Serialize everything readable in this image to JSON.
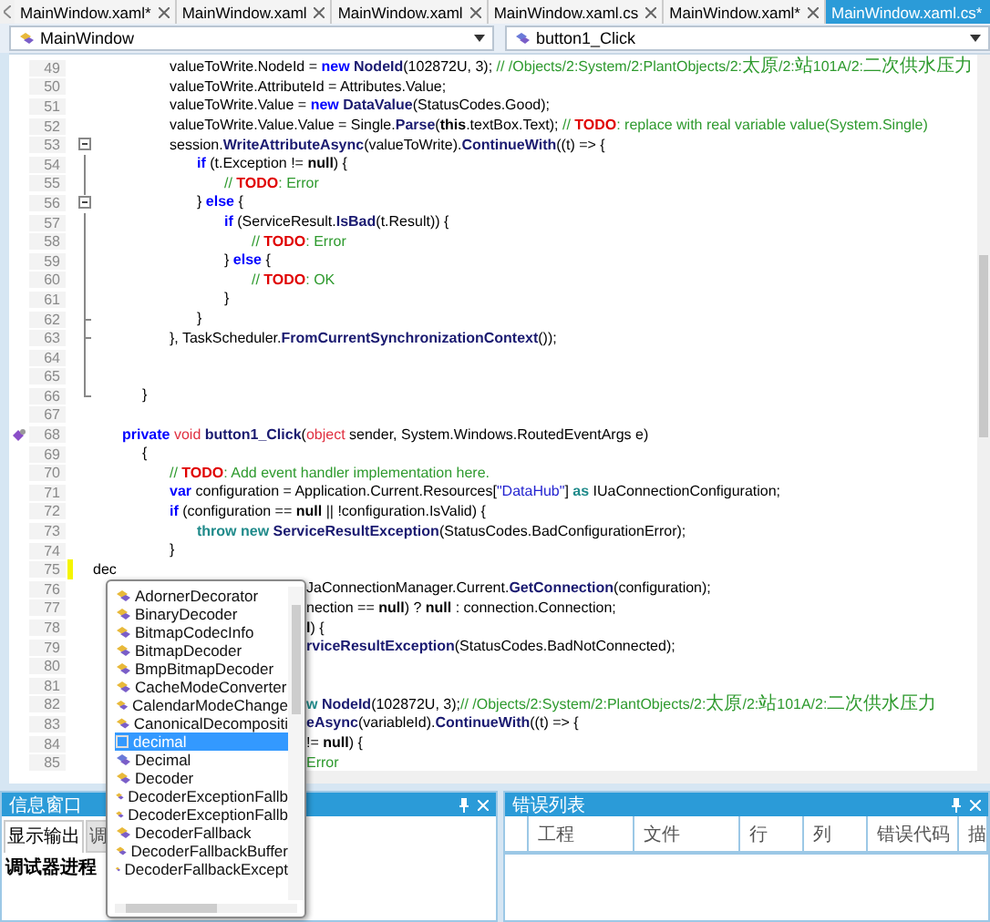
{
  "tabs": [
    {
      "label": "MainWindow.xaml*",
      "selected": false
    },
    {
      "label": "MainWindow.xaml",
      "selected": false
    },
    {
      "label": "MainWindow.xaml",
      "selected": false
    },
    {
      "label": "MainWindow.xaml.cs",
      "selected": false
    },
    {
      "label": "MainWindow.xaml*",
      "selected": false
    },
    {
      "label": "MainWindow.xaml.cs*",
      "selected": true
    }
  ],
  "type_dropdown": {
    "value": "MainWindow"
  },
  "member_dropdown": {
    "value": "button1_Click"
  },
  "editor": {
    "lines": [
      {
        "num": "49",
        "kind": "indent3",
        "tokens": [
          {
            "kind": "t",
            "text": "valueToWrite.NodeId = "
          },
          {
            "kind": "k",
            "text": "new "
          },
          {
            "kind": "m",
            "text": "NodeId"
          },
          {
            "kind": "t",
            "text": "(102872U, 3); "
          },
          {
            "kind": "c",
            "text": "// /Objects/2:System/2:PlantObjects/2:"
          },
          {
            "kind": "cjk",
            "text": "太原"
          },
          {
            "kind": "c",
            "text": "/2:"
          },
          {
            "kind": "cjk",
            "text": "站"
          },
          {
            "kind": "c",
            "text": "101A/2:"
          },
          {
            "kind": "cjk",
            "text": "二次供水压力"
          }
        ]
      },
      {
        "num": "50",
        "kind": "indent3",
        "tokens": [
          {
            "kind": "t",
            "text": "valueToWrite.AttributeId = Attributes.Value;"
          }
        ]
      },
      {
        "num": "51",
        "kind": "indent3",
        "tokens": [
          {
            "kind": "t",
            "text": "valueToWrite.Value = "
          },
          {
            "kind": "k",
            "text": "new "
          },
          {
            "kind": "m",
            "text": "DataValue"
          },
          {
            "kind": "t",
            "text": "(StatusCodes.Good);"
          }
        ]
      },
      {
        "num": "52",
        "kind": "indent3",
        "tokens": [
          {
            "kind": "t",
            "text": "valueToWrite.Value.Value = Single."
          },
          {
            "kind": "m",
            "text": "Parse"
          },
          {
            "kind": "t",
            "text": "("
          },
          {
            "kind": "b",
            "text": "this"
          },
          {
            "kind": "t",
            "text": ".textBox.Text); "
          },
          {
            "kind": "c",
            "text": "// "
          },
          {
            "kind": "todo",
            "text": "TODO"
          },
          {
            "kind": "c",
            "text": ": replace with real variable value(System.Single)"
          }
        ]
      },
      {
        "num": "53",
        "kind": "indent3",
        "fold": {
          "kind": "minus"
        },
        "tokens": [
          {
            "kind": "t",
            "text": "session."
          },
          {
            "kind": "m",
            "text": "WriteAttributeAsync"
          },
          {
            "kind": "t",
            "text": "(valueToWrite)."
          },
          {
            "kind": "m",
            "text": "ContinueWith"
          },
          {
            "kind": "t",
            "text": "((t) => {"
          }
        ]
      },
      {
        "num": "54",
        "kind": "indent4",
        "fold": {
          "kind": "line"
        },
        "tokens": [
          {
            "kind": "k",
            "text": "if"
          },
          {
            "kind": "t",
            "text": " (t.Exception != "
          },
          {
            "kind": "b",
            "text": "null"
          },
          {
            "kind": "t",
            "text": ") {"
          }
        ]
      },
      {
        "num": "55",
        "kind": "indent5",
        "fold": {
          "kind": "line"
        },
        "tokens": [
          {
            "kind": "c",
            "text": "// "
          },
          {
            "kind": "todo",
            "text": "TODO"
          },
          {
            "kind": "c",
            "text": ": Error"
          }
        ]
      },
      {
        "num": "56",
        "kind": "indent4",
        "fold": {
          "kind": "minus"
        },
        "tokens": [
          {
            "kind": "t",
            "text": "} "
          },
          {
            "kind": "k",
            "text": "else"
          },
          {
            "kind": "t",
            "text": " {"
          }
        ]
      },
      {
        "num": "57",
        "kind": "indent5",
        "fold": {
          "kind": "line"
        },
        "tokens": [
          {
            "kind": "k",
            "text": "if"
          },
          {
            "kind": "t",
            "text": " (ServiceResult."
          },
          {
            "kind": "m",
            "text": "IsBad"
          },
          {
            "kind": "t",
            "text": "(t.Result)) {"
          }
        ]
      },
      {
        "num": "58",
        "kind": "indent6",
        "fold": {
          "kind": "line"
        },
        "tokens": [
          {
            "kind": "c",
            "text": "// "
          },
          {
            "kind": "todo",
            "text": "TODO"
          },
          {
            "kind": "c",
            "text": ": Error"
          }
        ]
      },
      {
        "num": "59",
        "kind": "indent5",
        "fold": {
          "kind": "line"
        },
        "tokens": [
          {
            "kind": "t",
            "text": "} "
          },
          {
            "kind": "k",
            "text": "else"
          },
          {
            "kind": "t",
            "text": " {"
          }
        ]
      },
      {
        "num": "60",
        "kind": "indent6",
        "fold": {
          "kind": "line"
        },
        "tokens": [
          {
            "kind": "c",
            "text": "// "
          },
          {
            "kind": "todo",
            "text": "TODO"
          },
          {
            "kind": "c",
            "text": ": OK"
          }
        ]
      },
      {
        "num": "61",
        "kind": "indent5",
        "fold": {
          "kind": "line"
        },
        "tokens": [
          {
            "kind": "t",
            "text": "}"
          }
        ]
      },
      {
        "num": "62",
        "kind": "indent4",
        "fold": {
          "kind": "tick"
        },
        "tokens": [
          {
            "kind": "t",
            "text": "}"
          }
        ]
      },
      {
        "num": "63",
        "kind": "indent3",
        "fold": {
          "kind": "tick"
        },
        "tokens": [
          {
            "kind": "t",
            "text": "}, TaskScheduler."
          },
          {
            "kind": "m",
            "text": "FromCurrentSynchronizationContext"
          },
          {
            "kind": "t",
            "text": "());"
          }
        ]
      },
      {
        "num": "64",
        "fold": {
          "kind": "line"
        }
      },
      {
        "num": "65",
        "fold": {
          "kind": "line"
        }
      },
      {
        "num": "66",
        "kind": "indent2",
        "fold": {
          "kind": "end"
        },
        "tokens": [
          {
            "kind": "t",
            "text": "}"
          }
        ]
      },
      {
        "num": "67"
      },
      {
        "num": "68",
        "kind": "indent1",
        "gutter": {
          "kind": "method"
        },
        "tokens": [
          {
            "kind": "k",
            "text": "private "
          },
          {
            "kind": "r",
            "text": "void "
          },
          {
            "kind": "m",
            "text": "button1_Click"
          },
          {
            "kind": "t",
            "text": "("
          },
          {
            "kind": "r",
            "text": "object"
          },
          {
            "kind": "t",
            "text": " sender, System.Windows.RoutedEventArgs e)"
          }
        ]
      },
      {
        "num": "69",
        "kind": "indent2",
        "tokens": [
          {
            "kind": "t",
            "text": "{"
          }
        ]
      },
      {
        "num": "70",
        "kind": "indent3",
        "tokens": [
          {
            "kind": "c",
            "text": "// "
          },
          {
            "kind": "todo",
            "text": "TODO"
          },
          {
            "kind": "c",
            "text": ": Add event handler implementation here."
          }
        ]
      },
      {
        "num": "71",
        "kind": "indent3",
        "tokens": [
          {
            "kind": "k",
            "text": "var"
          },
          {
            "kind": "t",
            "text": " configuration = Application.Current.Resources["
          },
          {
            "kind": "s",
            "text": "\"DataHub\""
          },
          {
            "kind": "t",
            "text": "] "
          },
          {
            "kind": "tk",
            "text": "as"
          },
          {
            "kind": "t",
            "text": " IUaConnectionConfiguration;"
          }
        ]
      },
      {
        "num": "72",
        "kind": "indent3",
        "tokens": [
          {
            "kind": "k",
            "text": "if"
          },
          {
            "kind": "t",
            "text": " (configuration == "
          },
          {
            "kind": "b",
            "text": "null"
          },
          {
            "kind": "t",
            "text": " || !configuration.IsValid) {"
          }
        ]
      },
      {
        "num": "73",
        "kind": "indent4",
        "tokens": [
          {
            "kind": "tk",
            "text": "throw new "
          },
          {
            "kind": "m",
            "text": "ServiceResultException"
          },
          {
            "kind": "t",
            "text": "(StatusCodes.BadConfigurationError);"
          }
        ]
      },
      {
        "num": "74",
        "kind": "indent3",
        "tokens": [
          {
            "kind": "t",
            "text": "}"
          }
        ]
      },
      {
        "num": "75",
        "kind": "indent0",
        "gutter": {
          "kind": "changed"
        },
        "tokens": [
          {
            "kind": "t",
            "text": "dec"
          }
        ]
      },
      {
        "num": "76",
        "kind": "covered",
        "tokens": [
          {
            "kind": "t",
            "text": "JaConnectionManager.Current."
          },
          {
            "kind": "m",
            "text": "GetConnection"
          },
          {
            "kind": "t",
            "text": "(configuration);"
          }
        ]
      },
      {
        "num": "77",
        "kind": "covered",
        "tokens": [
          {
            "kind": "t",
            "text": "nection == "
          },
          {
            "kind": "b",
            "text": "null"
          },
          {
            "kind": "t",
            "text": ") ? "
          },
          {
            "kind": "b",
            "text": "null"
          },
          {
            "kind": "t",
            "text": " : connection.Connection;"
          }
        ]
      },
      {
        "num": "78",
        "kind": "covered",
        "tokens": [
          {
            "kind": "b",
            "text": "l"
          },
          {
            "kind": "t",
            "text": ") {"
          }
        ]
      },
      {
        "num": "79",
        "kind": "covered",
        "tokens": [
          {
            "kind": "m",
            "text": "rviceResultException"
          },
          {
            "kind": "t",
            "text": "(StatusCodes.BadNotConnected);"
          }
        ]
      },
      {
        "num": "80"
      },
      {
        "num": "81"
      },
      {
        "num": "82",
        "kind": "covered",
        "tokens": [
          {
            "kind": "tk",
            "text": "w "
          },
          {
            "kind": "m",
            "text": "NodeId"
          },
          {
            "kind": "t",
            "text": "(102872U, 3);"
          },
          {
            "kind": "c",
            "text": "// /Objects/2:System/2:PlantObjects/2:"
          },
          {
            "kind": "cjk",
            "text": "太原"
          },
          {
            "kind": "c",
            "text": "/2:"
          },
          {
            "kind": "cjk",
            "text": "站"
          },
          {
            "kind": "c",
            "text": "101A/2:"
          },
          {
            "kind": "cjk",
            "text": "二次供水压力"
          }
        ]
      },
      {
        "num": "83",
        "kind": "covered",
        "tokens": [
          {
            "kind": "m",
            "text": "eAsync"
          },
          {
            "kind": "t",
            "text": "(variableId)."
          },
          {
            "kind": "m",
            "text": "ContinueWith"
          },
          {
            "kind": "t",
            "text": "((t) => {"
          }
        ]
      },
      {
        "num": "84",
        "kind": "covered",
        "tokens": [
          {
            "kind": "t",
            "text": "!= "
          },
          {
            "kind": "b",
            "text": "null"
          },
          {
            "kind": "t",
            "text": ") {"
          }
        ]
      },
      {
        "num": "85",
        "kind": "covered",
        "tokens": [
          {
            "kind": "c",
            "text": "Error"
          }
        ]
      }
    ]
  },
  "completion": {
    "items": [
      {
        "label": "AdornerDecorator",
        "kind": "class",
        "selected": false
      },
      {
        "label": "BinaryDecoder",
        "kind": "class",
        "selected": false
      },
      {
        "label": "BitmapCodecInfo",
        "kind": "class",
        "selected": false
      },
      {
        "label": "BitmapDecoder",
        "kind": "class",
        "selected": false
      },
      {
        "label": "BmpBitmapDecoder",
        "kind": "class",
        "selected": false
      },
      {
        "label": "CacheModeConverter",
        "kind": "class",
        "selected": false
      },
      {
        "label": "CalendarModeChange",
        "kind": "class",
        "selected": false
      },
      {
        "label": "CanonicalDecompositi",
        "kind": "class",
        "selected": false
      },
      {
        "label": "decimal",
        "kind": "keyword",
        "selected": true
      },
      {
        "label": "Decimal",
        "kind": "struct",
        "selected": false
      },
      {
        "label": "Decoder",
        "kind": "class",
        "selected": false
      },
      {
        "label": "DecoderExceptionFallb",
        "kind": "class",
        "selected": false
      },
      {
        "label": "DecoderExceptionFallb",
        "kind": "class",
        "selected": false
      },
      {
        "label": "DecoderFallback",
        "kind": "class",
        "selected": false
      },
      {
        "label": "DecoderFallbackBuffer",
        "kind": "class",
        "selected": false
      },
      {
        "label": "DecoderFallbackExcept",
        "kind": "class",
        "selected": false
      }
    ]
  },
  "output_panel": {
    "title": "信息窗口",
    "tabs": [
      {
        "label": "显示输出",
        "selected": true
      },
      {
        "label": "调",
        "selected": false
      }
    ],
    "text": "调试器进程"
  },
  "error_panel": {
    "title": "错误列表",
    "columns": [
      "工程",
      "文件",
      "行",
      "列",
      "错误代码",
      "描"
    ]
  }
}
